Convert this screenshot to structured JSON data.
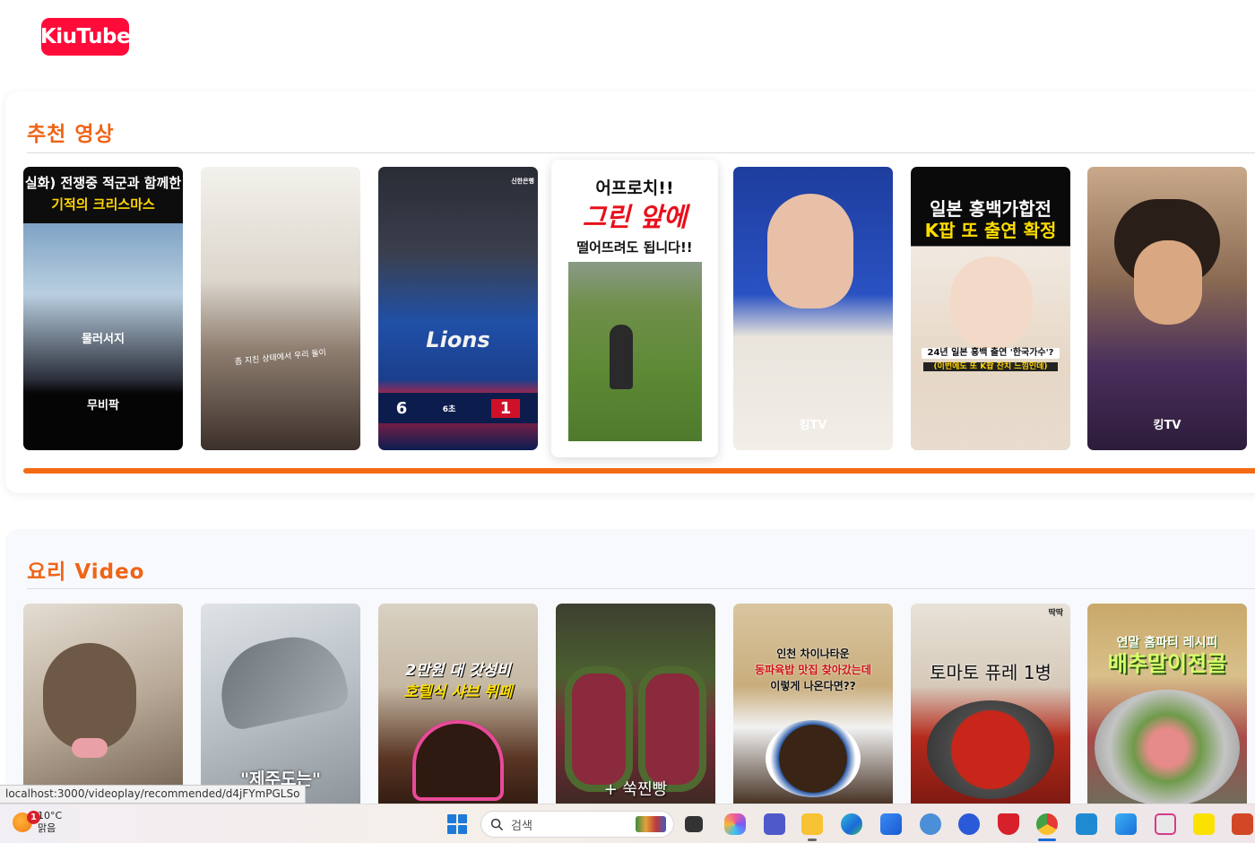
{
  "app": {
    "logo_text": "KiuTube",
    "brand_color": "#ff0b3a",
    "accent_color": "#f06416"
  },
  "sections": [
    {
      "title": "추천 영상",
      "videos": [
        {
          "caption_top": "실화) 전쟁중 적군과 함께한",
          "caption_top2": "기적의 크리스마스",
          "caption_mid": "물러서지",
          "caption_bottom": "무비팍"
        },
        {
          "caption_mid": "좀 지친 상태에서 우리 둘이"
        },
        {
          "caption_top": "신한은행",
          "score_left": "6",
          "score_right": "1",
          "score_mid": "6초",
          "team_text": "Lions"
        },
        {
          "caption_top": "어프로치!!",
          "caption_top2": "그린 앞에",
          "caption_top3": "떨어뜨려도 됩니다!!"
        },
        {
          "caption_bottom": "킹TV"
        },
        {
          "caption_top": "일본 홍백가합전",
          "caption_top2": "K팝 또 출연 확정",
          "caption_mid": "24년 일본 홍백 출연 '한국가수'?",
          "caption_mid2": "(이번에도 또 K팝 잔치 느낌인데)"
        },
        {
          "caption_bottom": "킹TV"
        }
      ]
    },
    {
      "title": "요리 Video",
      "videos": [
        {
          "caption_mid": ""
        },
        {
          "caption_bottom": "\"제주도는\""
        },
        {
          "caption_top": "2만원 대 갓성비",
          "caption_top2": "호텔식 샤브 뷔페"
        },
        {
          "caption_bottom": "+ 쑥찐빵"
        },
        {
          "caption_top": "인천 차이나타운",
          "caption_top2": "동파육밥 맛집 찾아갔는데",
          "caption_top3": "이렇게 나온다면??"
        },
        {
          "caption_top": "토마토 퓨레 1병",
          "caption_corner": "딱딱"
        },
        {
          "caption_top": "연말 홈파티 레시피",
          "caption_top2": "배추말이전골"
        }
      ]
    }
  ],
  "status_url": "localhost:3000/videoplay/recommended/d4jFYmPGLSo",
  "taskbar": {
    "weather_temp": "10°C",
    "weather_desc": "맑음",
    "weather_badge": "1",
    "search_placeholder": "검색",
    "apps": [
      "task-view-icon",
      "copilot-icon",
      "teams-icon",
      "file-explorer-icon",
      "edge-icon",
      "store-icon",
      "settings-icon",
      "app-icon",
      "security-icon",
      "chrome-icon",
      "vscode-icon",
      "photos-icon",
      "snipping-icon",
      "kakaotalk-icon",
      "powerpoint-icon"
    ]
  }
}
